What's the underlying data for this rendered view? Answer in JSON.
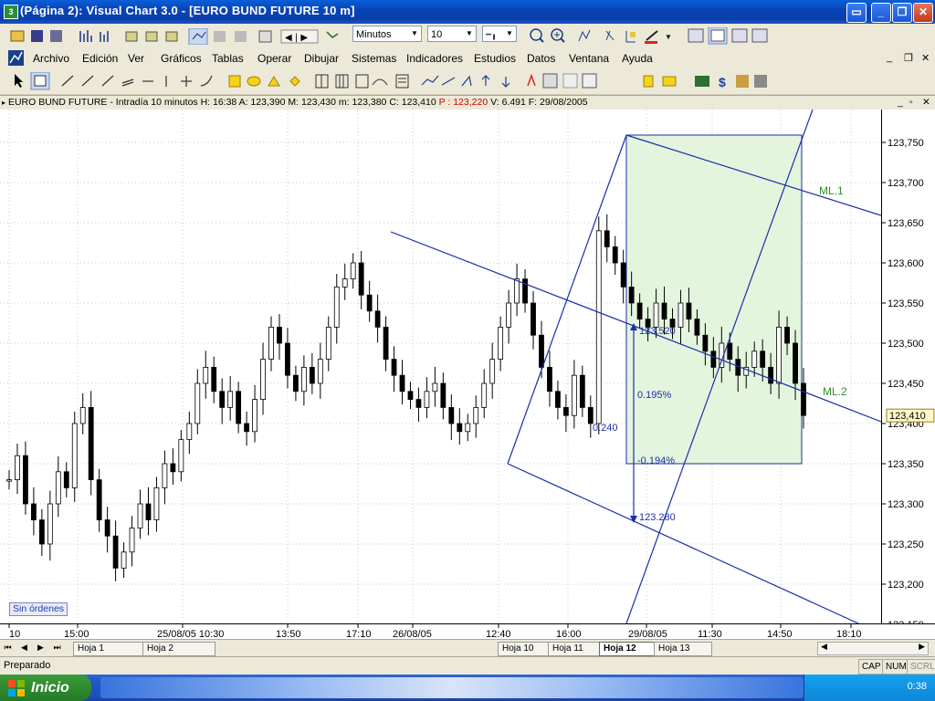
{
  "window": {
    "title": "(Página 2): Visual Chart  3.0 - [EURO BUND FUTURE 10 m]"
  },
  "toolbar1": {
    "period_select": "Minutos",
    "period_value": "10"
  },
  "menubar": {
    "items": [
      "Archivo",
      "Edición",
      "Ver",
      "Gráficos",
      "Tablas",
      "Operar",
      "Dibujar",
      "Sistemas",
      "Indicadores",
      "Estudios",
      "Datos",
      "Ventana",
      "Ayuda"
    ]
  },
  "chart_header": {
    "instrument": "EURO BUND FUTURE - Intradía 10 minutos",
    "h_label": "H:",
    "h_value": "16:38",
    "a_label": "A:",
    "a_value": "123,390",
    "m_label": "M:",
    "m_value": "123,430",
    "min_label": "m:",
    "min_value": "123,380",
    "c_label": "C:",
    "c_value": "123,410",
    "p_label": "P :",
    "p_value": "123,220",
    "v_label": "V:",
    "v_value": "6.491",
    "f_label": "F:",
    "f_value": "29/08/2005"
  },
  "chart_data": {
    "type": "candlestick",
    "price_ticks": [
      "123,750",
      "123,700",
      "123,650",
      "123,600",
      "123,550",
      "123,500",
      "123,450",
      "123,400",
      "123,350",
      "123,300",
      "123,250",
      "123,200",
      "123,150"
    ],
    "current_price_label": "123,410",
    "time_ticks": [
      "10",
      "15:00",
      "25/08/05 10:30",
      "13:50",
      "17:10",
      "26/08/05",
      "12:40",
      "16:00",
      "29/08/05",
      "11:30",
      "14:50",
      "18:10"
    ],
    "annotations": {
      "ml1": "ML.1",
      "ml2": "ML.2",
      "arrow_top": "123.520",
      "arrow_bottom": "123.280",
      "pct_up": "0.195%",
      "pct_down": "-0.194%",
      "small_value": "0.240"
    },
    "approx_closes": [
      123.33,
      123.36,
      123.3,
      123.28,
      123.25,
      123.3,
      123.34,
      123.32,
      123.4,
      123.42,
      123.33,
      123.28,
      123.26,
      123.22,
      123.24,
      123.27,
      123.3,
      123.28,
      123.32,
      123.35,
      123.34,
      123.38,
      123.4,
      123.45,
      123.47,
      123.44,
      123.42,
      123.44,
      123.4,
      123.39,
      123.43,
      123.48,
      123.52,
      123.5,
      123.46,
      123.44,
      123.47,
      123.45,
      123.48,
      123.52,
      123.57,
      123.58,
      123.6,
      123.56,
      123.54,
      123.52,
      123.48,
      123.46,
      123.44,
      123.43,
      123.42,
      123.44,
      123.45,
      123.42,
      123.4,
      123.39,
      123.4,
      123.42,
      123.45,
      123.48,
      123.52,
      123.55,
      123.58,
      123.55,
      123.51,
      123.47,
      123.44,
      123.42,
      123.41,
      123.46,
      123.42,
      123.4,
      123.64,
      123.62,
      123.6,
      123.57,
      123.55,
      123.53,
      123.52,
      123.55,
      123.53,
      123.52,
      123.55,
      123.53,
      123.51,
      123.49,
      123.47,
      123.5,
      123.48,
      123.46,
      123.47,
      123.49,
      123.47,
      123.45,
      123.52,
      123.5,
      123.45,
      123.41
    ],
    "sin_ordenes": "Sin órdenes"
  },
  "sheet_tabs": [
    "Hoja 1",
    "Hoja 2",
    "Hoja 10",
    "Hoja 11",
    "Hoja 12",
    "Hoja 13"
  ],
  "statusbar": {
    "text": "Preparado",
    "cap": "CAP",
    "num": "NUM",
    "scrl": "SCRL"
  },
  "taskbar": {
    "start_label": "Inicio",
    "clock": "0:38"
  },
  "colors": {
    "title_blue": "#0a4fc8",
    "fibo_box": "#e6f6e0",
    "pitchfork_line": "#1a2fa8",
    "ml_label": "#2f8f2f",
    "p_value_red": "#d00000"
  }
}
